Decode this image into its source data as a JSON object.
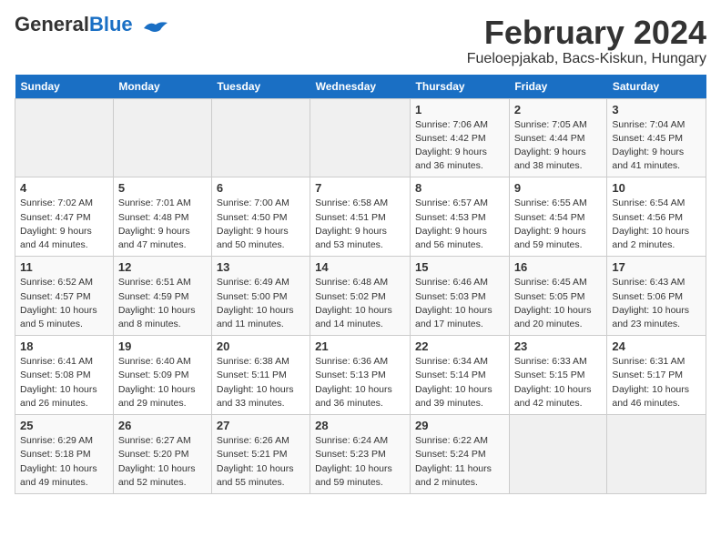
{
  "header": {
    "logo_general": "General",
    "logo_blue": "Blue",
    "month": "February 2024",
    "location": "Fueloepjakab, Bacs-Kiskun, Hungary"
  },
  "weekdays": [
    "Sunday",
    "Monday",
    "Tuesday",
    "Wednesday",
    "Thursday",
    "Friday",
    "Saturday"
  ],
  "weeks": [
    [
      {
        "day": "",
        "info": ""
      },
      {
        "day": "",
        "info": ""
      },
      {
        "day": "",
        "info": ""
      },
      {
        "day": "",
        "info": ""
      },
      {
        "day": "1",
        "info": "Sunrise: 7:06 AM\nSunset: 4:42 PM\nDaylight: 9 hours\nand 36 minutes."
      },
      {
        "day": "2",
        "info": "Sunrise: 7:05 AM\nSunset: 4:44 PM\nDaylight: 9 hours\nand 38 minutes."
      },
      {
        "day": "3",
        "info": "Sunrise: 7:04 AM\nSunset: 4:45 PM\nDaylight: 9 hours\nand 41 minutes."
      }
    ],
    [
      {
        "day": "4",
        "info": "Sunrise: 7:02 AM\nSunset: 4:47 PM\nDaylight: 9 hours\nand 44 minutes."
      },
      {
        "day": "5",
        "info": "Sunrise: 7:01 AM\nSunset: 4:48 PM\nDaylight: 9 hours\nand 47 minutes."
      },
      {
        "day": "6",
        "info": "Sunrise: 7:00 AM\nSunset: 4:50 PM\nDaylight: 9 hours\nand 50 minutes."
      },
      {
        "day": "7",
        "info": "Sunrise: 6:58 AM\nSunset: 4:51 PM\nDaylight: 9 hours\nand 53 minutes."
      },
      {
        "day": "8",
        "info": "Sunrise: 6:57 AM\nSunset: 4:53 PM\nDaylight: 9 hours\nand 56 minutes."
      },
      {
        "day": "9",
        "info": "Sunrise: 6:55 AM\nSunset: 4:54 PM\nDaylight: 9 hours\nand 59 minutes."
      },
      {
        "day": "10",
        "info": "Sunrise: 6:54 AM\nSunset: 4:56 PM\nDaylight: 10 hours\nand 2 minutes."
      }
    ],
    [
      {
        "day": "11",
        "info": "Sunrise: 6:52 AM\nSunset: 4:57 PM\nDaylight: 10 hours\nand 5 minutes."
      },
      {
        "day": "12",
        "info": "Sunrise: 6:51 AM\nSunset: 4:59 PM\nDaylight: 10 hours\nand 8 minutes."
      },
      {
        "day": "13",
        "info": "Sunrise: 6:49 AM\nSunset: 5:00 PM\nDaylight: 10 hours\nand 11 minutes."
      },
      {
        "day": "14",
        "info": "Sunrise: 6:48 AM\nSunset: 5:02 PM\nDaylight: 10 hours\nand 14 minutes."
      },
      {
        "day": "15",
        "info": "Sunrise: 6:46 AM\nSunset: 5:03 PM\nDaylight: 10 hours\nand 17 minutes."
      },
      {
        "day": "16",
        "info": "Sunrise: 6:45 AM\nSunset: 5:05 PM\nDaylight: 10 hours\nand 20 minutes."
      },
      {
        "day": "17",
        "info": "Sunrise: 6:43 AM\nSunset: 5:06 PM\nDaylight: 10 hours\nand 23 minutes."
      }
    ],
    [
      {
        "day": "18",
        "info": "Sunrise: 6:41 AM\nSunset: 5:08 PM\nDaylight: 10 hours\nand 26 minutes."
      },
      {
        "day": "19",
        "info": "Sunrise: 6:40 AM\nSunset: 5:09 PM\nDaylight: 10 hours\nand 29 minutes."
      },
      {
        "day": "20",
        "info": "Sunrise: 6:38 AM\nSunset: 5:11 PM\nDaylight: 10 hours\nand 33 minutes."
      },
      {
        "day": "21",
        "info": "Sunrise: 6:36 AM\nSunset: 5:13 PM\nDaylight: 10 hours\nand 36 minutes."
      },
      {
        "day": "22",
        "info": "Sunrise: 6:34 AM\nSunset: 5:14 PM\nDaylight: 10 hours\nand 39 minutes."
      },
      {
        "day": "23",
        "info": "Sunrise: 6:33 AM\nSunset: 5:15 PM\nDaylight: 10 hours\nand 42 minutes."
      },
      {
        "day": "24",
        "info": "Sunrise: 6:31 AM\nSunset: 5:17 PM\nDaylight: 10 hours\nand 46 minutes."
      }
    ],
    [
      {
        "day": "25",
        "info": "Sunrise: 6:29 AM\nSunset: 5:18 PM\nDaylight: 10 hours\nand 49 minutes."
      },
      {
        "day": "26",
        "info": "Sunrise: 6:27 AM\nSunset: 5:20 PM\nDaylight: 10 hours\nand 52 minutes."
      },
      {
        "day": "27",
        "info": "Sunrise: 6:26 AM\nSunset: 5:21 PM\nDaylight: 10 hours\nand 55 minutes."
      },
      {
        "day": "28",
        "info": "Sunrise: 6:24 AM\nSunset: 5:23 PM\nDaylight: 10 hours\nand 59 minutes."
      },
      {
        "day": "29",
        "info": "Sunrise: 6:22 AM\nSunset: 5:24 PM\nDaylight: 11 hours\nand 2 minutes."
      },
      {
        "day": "",
        "info": ""
      },
      {
        "day": "",
        "info": ""
      }
    ]
  ]
}
